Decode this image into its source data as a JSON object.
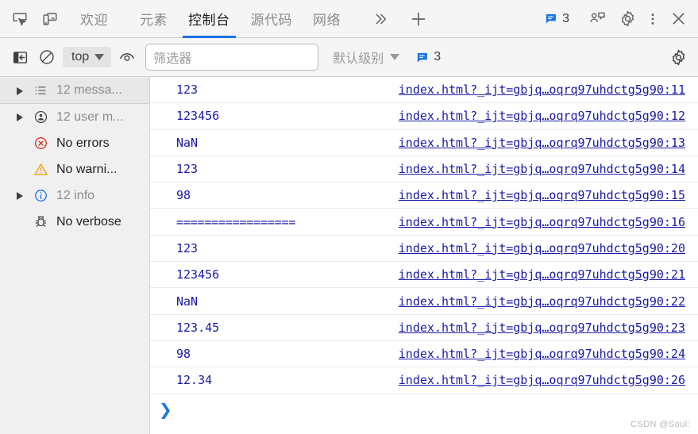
{
  "tabbar": {
    "inspect_icon": "inspect-cursor-icon",
    "device_icon": "device-toolbar-icon",
    "tabs": [
      {
        "label": "欢迎",
        "active": false
      },
      {
        "label": "元素",
        "active": false
      },
      {
        "label": "控制台",
        "active": true
      },
      {
        "label": "源代码",
        "active": false
      },
      {
        "label": "网络",
        "active": false
      }
    ],
    "overflow_label": "≫",
    "add_label": "+",
    "message_count": "3",
    "feedback_icon": "feedback-icon",
    "settings_icon": "gear-icon",
    "more_icon": "kebab-menu-icon",
    "close_icon": "close-icon"
  },
  "console_toolbar": {
    "sidebar_toggle_icon": "sidebar-toggle-icon",
    "clear_icon": "clear-console-icon",
    "context_value": "top",
    "live_expression_icon": "eye-icon",
    "filter_placeholder": "筛选器",
    "filter_value": "",
    "level_label": "默认级别",
    "level_count": "3",
    "settings_icon": "gear-icon"
  },
  "sidebar": {
    "items": [
      {
        "label": "12 messa...",
        "icon": "list-icon",
        "expandable": true,
        "selected": true,
        "muted": true
      },
      {
        "label": "12 user m...",
        "icon": "user-message-icon",
        "expandable": true,
        "selected": false,
        "muted": true
      },
      {
        "label": "No errors",
        "icon": "error-icon",
        "expandable": false,
        "selected": false,
        "muted": false
      },
      {
        "label": "No warni...",
        "icon": "warning-icon",
        "expandable": false,
        "selected": false,
        "muted": false
      },
      {
        "label": "12 info",
        "icon": "info-icon",
        "expandable": true,
        "selected": false,
        "muted": true
      },
      {
        "label": "No verbose",
        "icon": "bug-icon",
        "expandable": false,
        "selected": false,
        "muted": false
      }
    ]
  },
  "console": {
    "rows": [
      {
        "value": "123",
        "source": "index.html?_ijt=gbjq…oqrq97uhdctg5g90:11"
      },
      {
        "value": "123456",
        "source": "index.html?_ijt=gbjq…oqrq97uhdctg5g90:12"
      },
      {
        "value": "NaN",
        "source": "index.html?_ijt=gbjq…oqrq97uhdctg5g90:13"
      },
      {
        "value": "123",
        "source": "index.html?_ijt=gbjq…oqrq97uhdctg5g90:14"
      },
      {
        "value": "98",
        "source": "index.html?_ijt=gbjq…oqrq97uhdctg5g90:15"
      },
      {
        "value": "=================",
        "source": "index.html?_ijt=gbjq…oqrq97uhdctg5g90:16"
      },
      {
        "value": "123",
        "source": "index.html?_ijt=gbjq…oqrq97uhdctg5g90:20"
      },
      {
        "value": "123456",
        "source": "index.html?_ijt=gbjq…oqrq97uhdctg5g90:21"
      },
      {
        "value": "NaN",
        "source": "index.html?_ijt=gbjq…oqrq97uhdctg5g90:22"
      },
      {
        "value": "123.45",
        "source": "index.html?_ijt=gbjq…oqrq97uhdctg5g90:23"
      },
      {
        "value": "98",
        "source": "index.html?_ijt=gbjq…oqrq97uhdctg5g90:24"
      },
      {
        "value": "12.34",
        "source": "index.html?_ijt=gbjq…oqrq97uhdctg5g90:26"
      }
    ],
    "prompt_symbol": "❯"
  },
  "watermark": "CSDN @Soul:",
  "colors": {
    "accent": "#1a73e8",
    "log_text": "#1a1aa6",
    "error": "#d93025",
    "warning": "#f29900",
    "info": "#1a73e8",
    "toolbar_bg": "#f5f5f5",
    "sidebar_bg": "#f0f0f0"
  }
}
